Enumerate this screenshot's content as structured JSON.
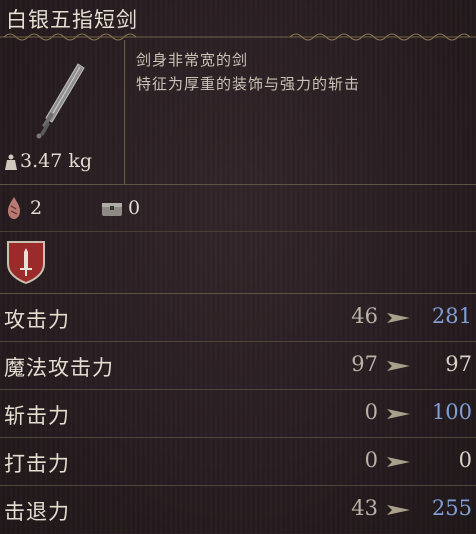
{
  "item": {
    "name": "白银五指短剑",
    "icon": "dagger-icon",
    "weight": "3.47 kg",
    "description": [
      "剑身非常宽的剑",
      "特征为厚重的装饰与强力的斩击"
    ]
  },
  "counts": {
    "blood_value": "2",
    "chest_value": "0"
  },
  "stats": [
    {
      "label": "攻击力",
      "base": "46",
      "final": "281",
      "boosted": true
    },
    {
      "label": "魔法攻击力",
      "base": "97",
      "final": "97",
      "boosted": false
    },
    {
      "label": "斩击力",
      "base": "0",
      "final": "100",
      "boosted": true
    },
    {
      "label": "打击力",
      "base": "0",
      "final": "0",
      "boosted": false
    },
    {
      "label": "击退力",
      "base": "43",
      "final": "255",
      "boosted": true
    }
  ],
  "colors": {
    "boosted": "#7f9fd6",
    "normal": "#d8d2c5",
    "background": "#2a1f22",
    "accent_red": "#9b2a2a"
  }
}
